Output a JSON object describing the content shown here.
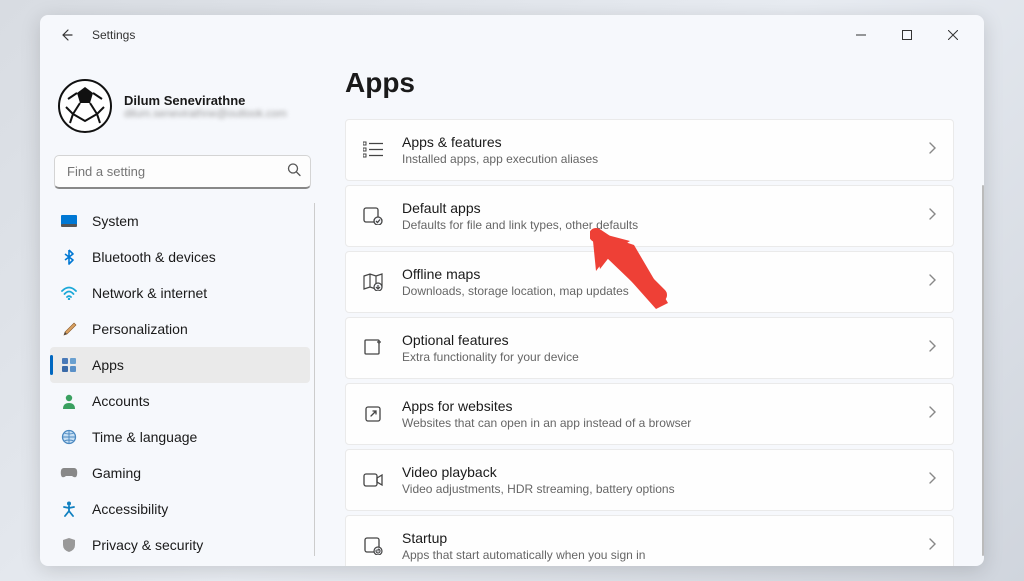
{
  "titlebar": {
    "title": "Settings"
  },
  "profile": {
    "name": "Dilum Senevirathne",
    "email": "dilum.senevirathne@outlook.com"
  },
  "search": {
    "placeholder": "Find a setting"
  },
  "nav": {
    "items": [
      {
        "label": "System"
      },
      {
        "label": "Bluetooth & devices"
      },
      {
        "label": "Network & internet"
      },
      {
        "label": "Personalization"
      },
      {
        "label": "Apps"
      },
      {
        "label": "Accounts"
      },
      {
        "label": "Time & language"
      },
      {
        "label": "Gaming"
      },
      {
        "label": "Accessibility"
      },
      {
        "label": "Privacy & security"
      }
    ]
  },
  "page": {
    "title": "Apps"
  },
  "cards": [
    {
      "title": "Apps & features",
      "sub": "Installed apps, app execution aliases"
    },
    {
      "title": "Default apps",
      "sub": "Defaults for file and link types, other defaults"
    },
    {
      "title": "Offline maps",
      "sub": "Downloads, storage location, map updates"
    },
    {
      "title": "Optional features",
      "sub": "Extra functionality for your device"
    },
    {
      "title": "Apps for websites",
      "sub": "Websites that can open in an app instead of a browser"
    },
    {
      "title": "Video playback",
      "sub": "Video adjustments, HDR streaming, battery options"
    },
    {
      "title": "Startup",
      "sub": "Apps that start automatically when you sign in"
    }
  ]
}
